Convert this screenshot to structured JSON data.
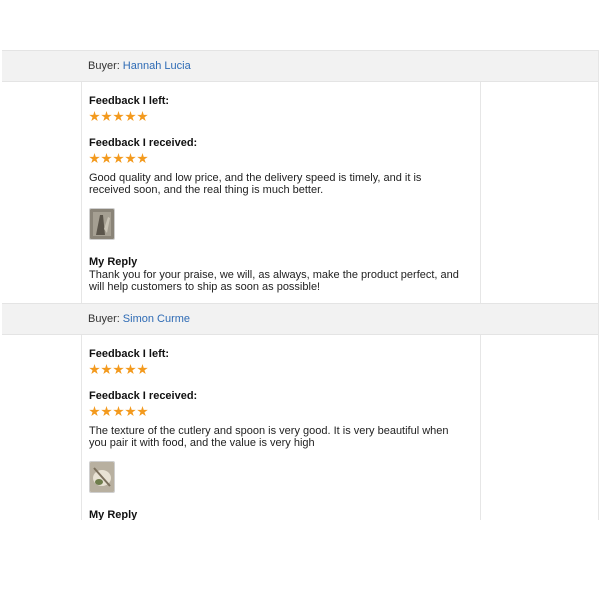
{
  "reviews": [
    {
      "buyer_label": "Buyer:",
      "buyer_name": "Hannah Lucia",
      "feedback_left_label": "Feedback I left:",
      "feedback_left_stars": 5,
      "feedback_received_label": "Feedback I received:",
      "feedback_received_stars": 5,
      "comment": "Good quality and low price, and the delivery speed is timely, and it is received soon, and the real thing is much better.",
      "reply_label": "My Reply",
      "reply": "Thank you for your praise, we will, as always, make the product perfect, and will help customers to ship as soon as possible!"
    },
    {
      "buyer_label": "Buyer:",
      "buyer_name": "Simon Curme",
      "feedback_left_label": "Feedback I left:",
      "feedback_left_stars": 5,
      "feedback_received_label": "Feedback I received:",
      "feedback_received_stars": 5,
      "comment": "The texture of the cutlery and spoon is very good. It is very beautiful when you pair it with food, and the value is very high",
      "reply_label": "My Reply",
      "reply": ""
    }
  ],
  "colors": {
    "star": "#f39a1e",
    "link": "#2e6bb5",
    "header_bg": "#f2f2f2"
  }
}
